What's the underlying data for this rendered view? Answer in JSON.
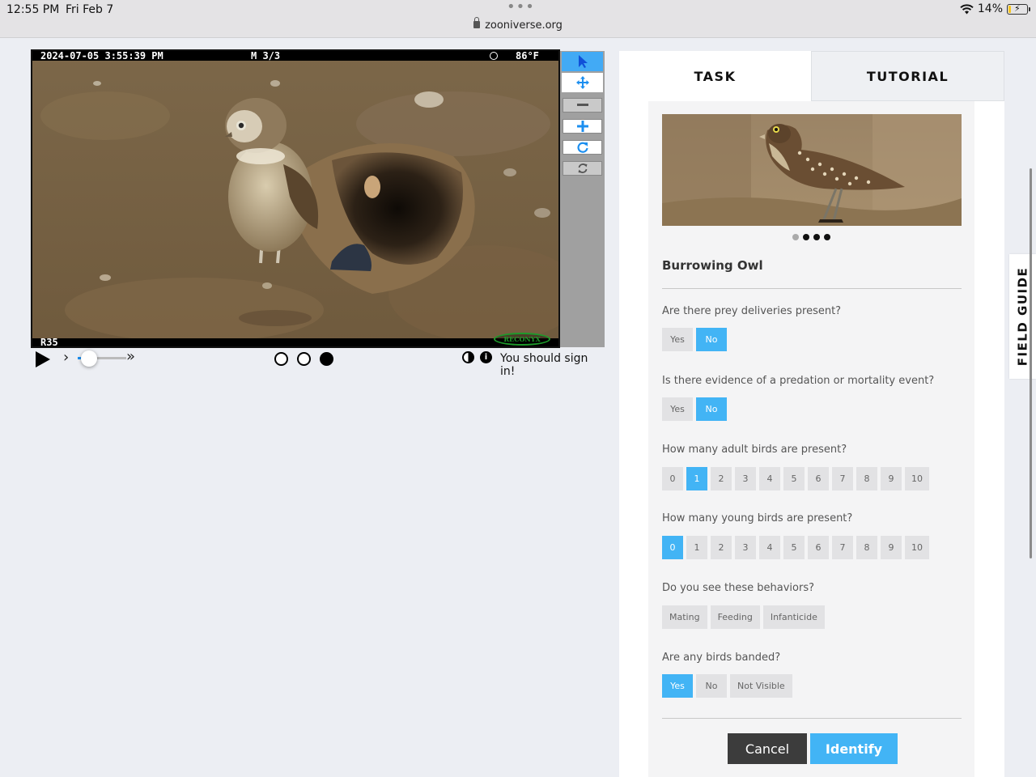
{
  "status_bar": {
    "time": "12:55 PM",
    "date": "Fri Feb 7",
    "url": "zooniverse.org",
    "battery": "14%",
    "battery_level": 0.14
  },
  "camera": {
    "timestamp": "2024-07-05 3:55:39 PM",
    "frame": "M 3/3",
    "temperature": "86°F",
    "camera_id": "R35",
    "brand": "RECONYX"
  },
  "toolbar": {
    "tools": [
      "pointer-icon",
      "move-icon",
      "zoom-out-icon",
      "zoom-in-icon",
      "rotate-icon",
      "reset-icon"
    ]
  },
  "controls": {
    "frames": [
      false,
      false,
      true
    ],
    "sign_in_text": "You should sign in!"
  },
  "tabs": {
    "task": "TASK",
    "tutorial": "TUTORIAL"
  },
  "field_guide": "FIELD GUIDE",
  "task": {
    "species": "Burrowing Owl",
    "carousel": [
      false,
      true,
      true,
      true
    ],
    "questions": {
      "prey": {
        "text": "Are there prey deliveries present?",
        "options": [
          "Yes",
          "No"
        ],
        "selected": "No"
      },
      "predation": {
        "text": "Is there evidence of a predation or mortality event?",
        "options": [
          "Yes",
          "No"
        ],
        "selected": "No"
      },
      "adults": {
        "text": "How many adult birds are present?",
        "options": [
          "0",
          "1",
          "2",
          "3",
          "4",
          "5",
          "6",
          "7",
          "8",
          "9",
          "10"
        ],
        "selected": "1"
      },
      "young": {
        "text": "How many young birds are present?",
        "options": [
          "0",
          "1",
          "2",
          "3",
          "4",
          "5",
          "6",
          "7",
          "8",
          "9",
          "10"
        ],
        "selected": "0"
      },
      "behaviors": {
        "text": "Do you see these behaviors?",
        "options": [
          "Mating",
          "Feeding",
          "Infanticide"
        ]
      },
      "banded": {
        "text": "Are any birds banded?",
        "options": [
          "Yes",
          "No",
          "Not Visible"
        ],
        "selected": "Yes"
      }
    },
    "cancel": "Cancel",
    "identify": "Identify"
  }
}
